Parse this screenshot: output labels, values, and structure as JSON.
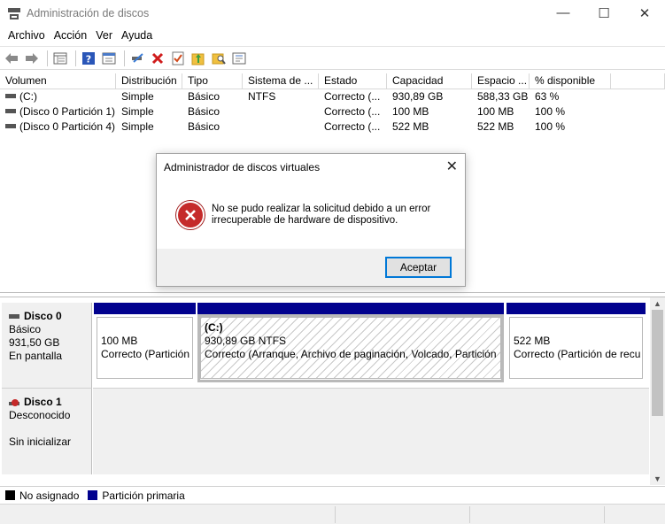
{
  "window": {
    "title": "Administración de discos",
    "minimize": "—",
    "maximize": "☐",
    "close": "✕"
  },
  "menu": [
    "Archivo",
    "Acción",
    "Ver",
    "Ayuda"
  ],
  "toolbar_icons": [
    "back-icon",
    "forward-icon",
    "list-view-icon",
    "help-icon",
    "properties-icon",
    "connect-icon",
    "delete-icon",
    "check-icon",
    "folder-up-icon",
    "search-folder-icon",
    "console-icon"
  ],
  "volumes": {
    "headers": [
      "Volumen",
      "Distribución",
      "Tipo",
      "Sistema de ...",
      "Estado",
      "Capacidad",
      "Espacio ...",
      "% disponible",
      ""
    ],
    "rows": [
      [
        "(C:)",
        "Simple",
        "Básico",
        "NTFS",
        "Correcto (...",
        "930,89 GB",
        "588,33 GB",
        "63 %"
      ],
      [
        "(Disco 0 Partición 1)",
        "Simple",
        "Básico",
        "",
        "Correcto (...",
        "100 MB",
        "100 MB",
        "100 %"
      ],
      [
        "(Disco 0 Partición 4)",
        "Simple",
        "Básico",
        "",
        "Correcto (...",
        "522 MB",
        "522 MB",
        "100 %"
      ]
    ]
  },
  "dialog": {
    "title": "Administrador de discos virtuales",
    "message": "No se pudo realizar la solicitud debido a un error irrecuperable de hardware de dispositivo.",
    "ok": "Aceptar"
  },
  "disks": [
    {
      "name": "Disco 0",
      "type": "Básico",
      "size": "931,50 GB",
      "status": "En pantalla",
      "partitions": [
        {
          "title": "",
          "line1": "100 MB",
          "line2": "Correcto (Partición"
        },
        {
          "title": "(C:)",
          "line1": "930,89 GB NTFS",
          "line2": "Correcto (Arranque, Archivo de paginación, Volcado, Partición"
        },
        {
          "title": "",
          "line1": "522 MB",
          "line2": "Correcto (Partición de recu"
        }
      ]
    },
    {
      "name": "Disco 1",
      "type": "Desconocido",
      "size": "",
      "status": "Sin inicializar"
    }
  ],
  "legend": [
    {
      "label": "No asignado",
      "color": "#000000"
    },
    {
      "label": "Partición primaria",
      "color": "#01018e"
    }
  ]
}
